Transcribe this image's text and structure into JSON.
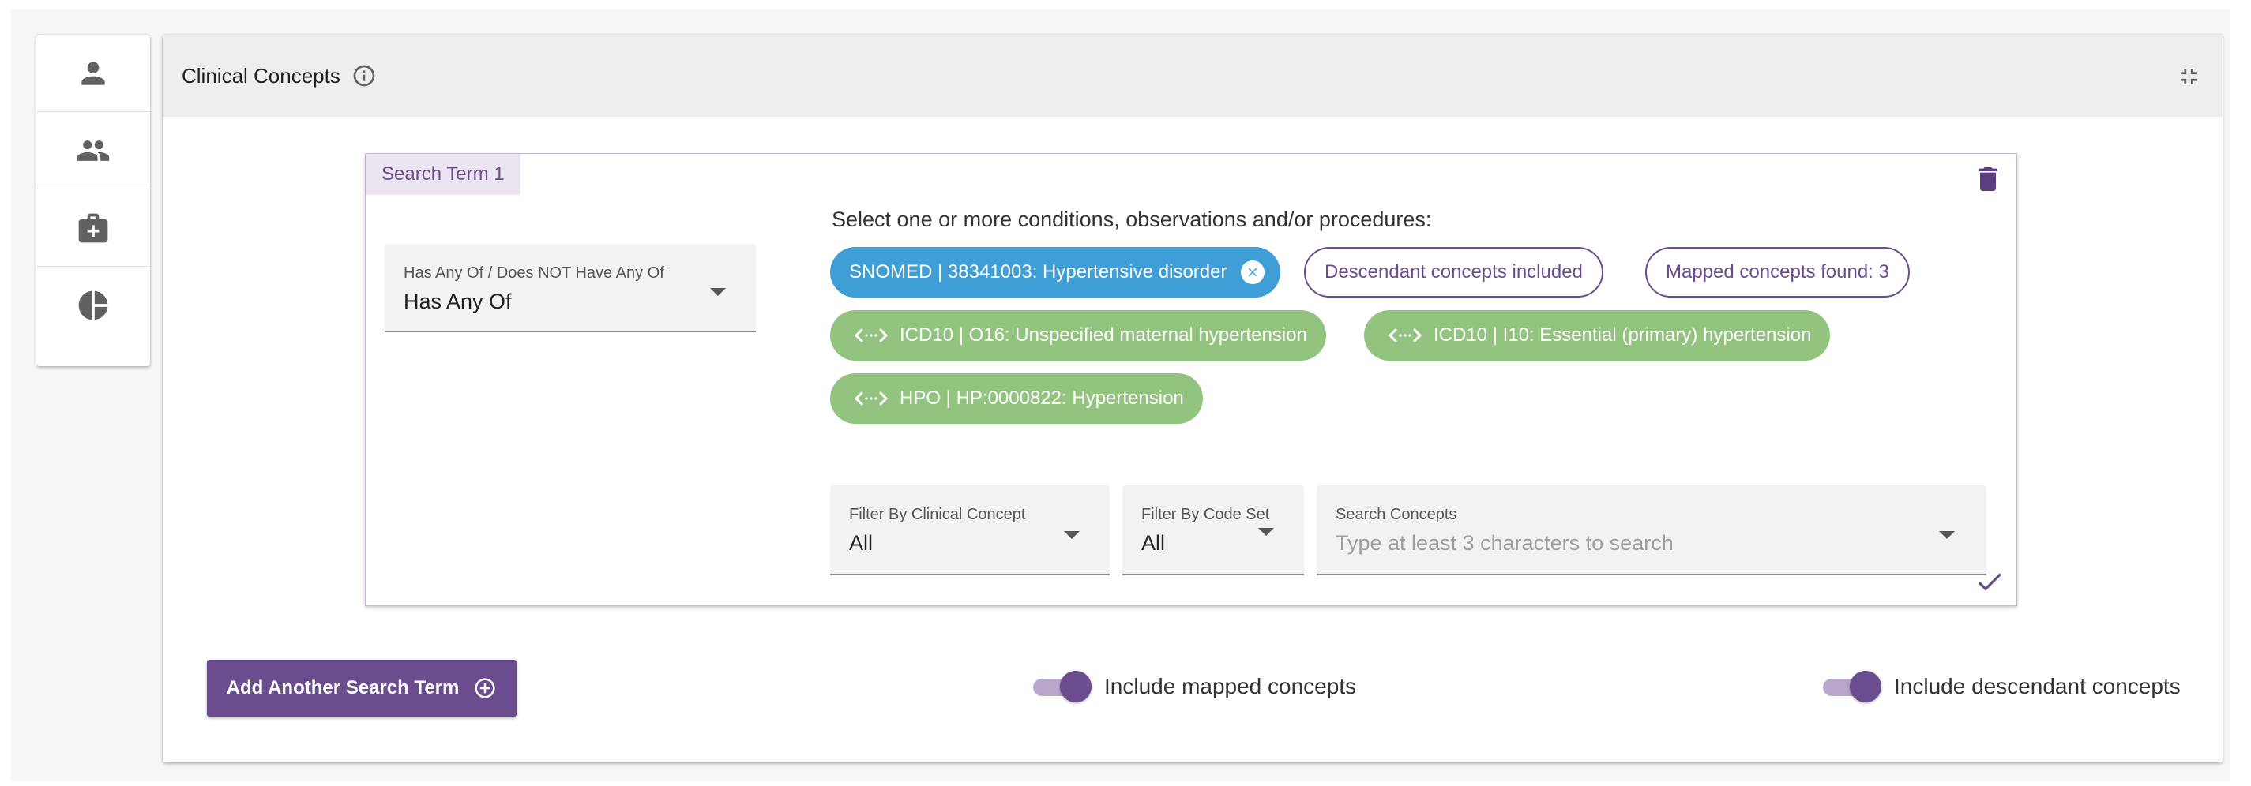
{
  "sidebar": {
    "items": [
      {
        "icon": "person-icon"
      },
      {
        "icon": "people-icon"
      },
      {
        "icon": "medical-bag-icon"
      },
      {
        "icon": "pie-chart-icon"
      }
    ]
  },
  "panel": {
    "title": "Clinical Concepts"
  },
  "search_term": {
    "tag": "Search Term 1",
    "has_any_select": {
      "label": "Has Any Of / Does NOT Have Any Of",
      "value": "Has Any Of"
    },
    "instruction": "Select one or more conditions, observations and/or procedures:",
    "selected_chip": "SNOMED | 38341003: Hypertensive disorder",
    "descendant_chip": "Descendant concepts included",
    "mapped_chip": "Mapped concepts found: 3",
    "mapped_concepts": [
      "ICD10 | O16: Unspecified maternal hypertension",
      "ICD10 | I10: Essential (primary) hypertension",
      "HPO | HP:0000822: Hypertension"
    ],
    "filter_clinical": {
      "label": "Filter By Clinical Concept",
      "value": "All"
    },
    "filter_codeset": {
      "label": "Filter By Code Set",
      "value": "All"
    },
    "search_concepts": {
      "label": "Search Concepts",
      "placeholder": "Type at least 3 characters to search"
    }
  },
  "footer": {
    "add_button": "Add Another Search Term",
    "toggle_mapped": {
      "label": "Include mapped concepts",
      "on": true
    },
    "toggle_descendant": {
      "label": "Include descendant concepts",
      "on": true
    }
  },
  "colors": {
    "accent": "#6b4c8e",
    "chip_blue": "#3f9ed6",
    "chip_green": "#92c47f"
  }
}
